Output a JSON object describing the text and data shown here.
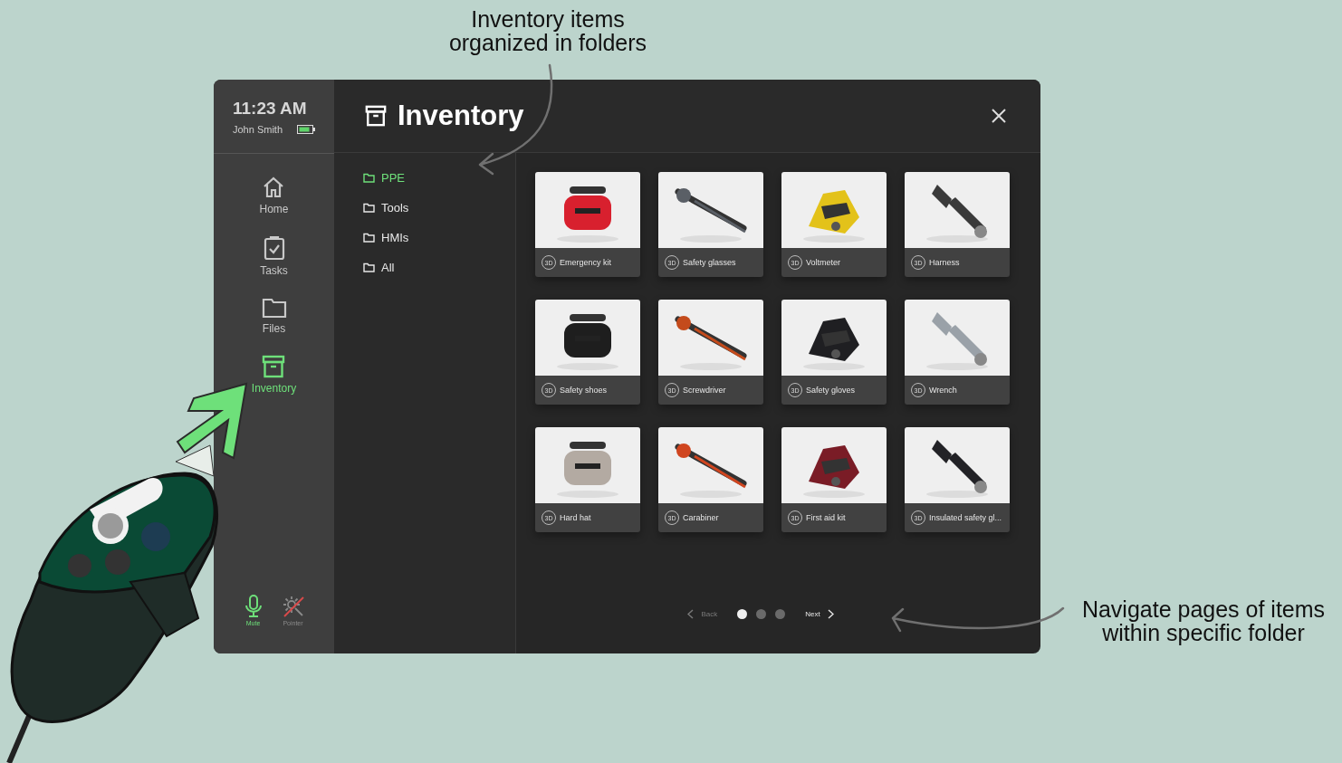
{
  "annotations": [
    {
      "lines": [
        "Inventory items",
        "organized in folders"
      ]
    },
    {
      "lines": [
        "Navigate pages of items",
        "within specific folder"
      ]
    }
  ],
  "status": {
    "time": "11:23 AM",
    "user": "John Smith"
  },
  "nav": [
    {
      "label": "Home",
      "selected": false
    },
    {
      "label": "Tasks",
      "selected": false
    },
    {
      "label": "Files",
      "selected": false
    },
    {
      "label": "Inventory",
      "selected": true
    }
  ],
  "toggles": [
    {
      "label": "Mute",
      "on": true
    },
    {
      "label": "Pointer",
      "on": false
    }
  ],
  "title": "Inventory",
  "folders": [
    {
      "label": "PPE",
      "selected": true
    },
    {
      "label": "Tools",
      "selected": false
    },
    {
      "label": "HMIs",
      "selected": false
    },
    {
      "label": "All",
      "selected": false
    }
  ],
  "items": [
    {
      "badge": "3D",
      "name": "Emergency kit"
    },
    {
      "badge": "3D",
      "name": "Safety glasses"
    },
    {
      "badge": "3D",
      "name": "Voltmeter"
    },
    {
      "badge": "3D",
      "name": "Harness"
    },
    {
      "badge": "3D",
      "name": "Safety shoes"
    },
    {
      "badge": "3D",
      "name": "Screwdriver"
    },
    {
      "badge": "3D",
      "name": "Safety gloves"
    },
    {
      "badge": "3D",
      "name": "Wrench"
    },
    {
      "badge": "3D",
      "name": "Hard hat"
    },
    {
      "badge": "3D",
      "name": "Carabiner"
    },
    {
      "badge": "3D",
      "name": "First aid kit"
    },
    {
      "badge": "3D",
      "name": "Insulated safety gl..."
    }
  ],
  "pager": {
    "back": {
      "label": "Back",
      "disabled": true
    },
    "pages": [
      {
        "selected": true
      },
      {
        "selected": false
      },
      {
        "selected": false
      }
    ],
    "next": {
      "label": "Next",
      "disabled": false
    }
  }
}
